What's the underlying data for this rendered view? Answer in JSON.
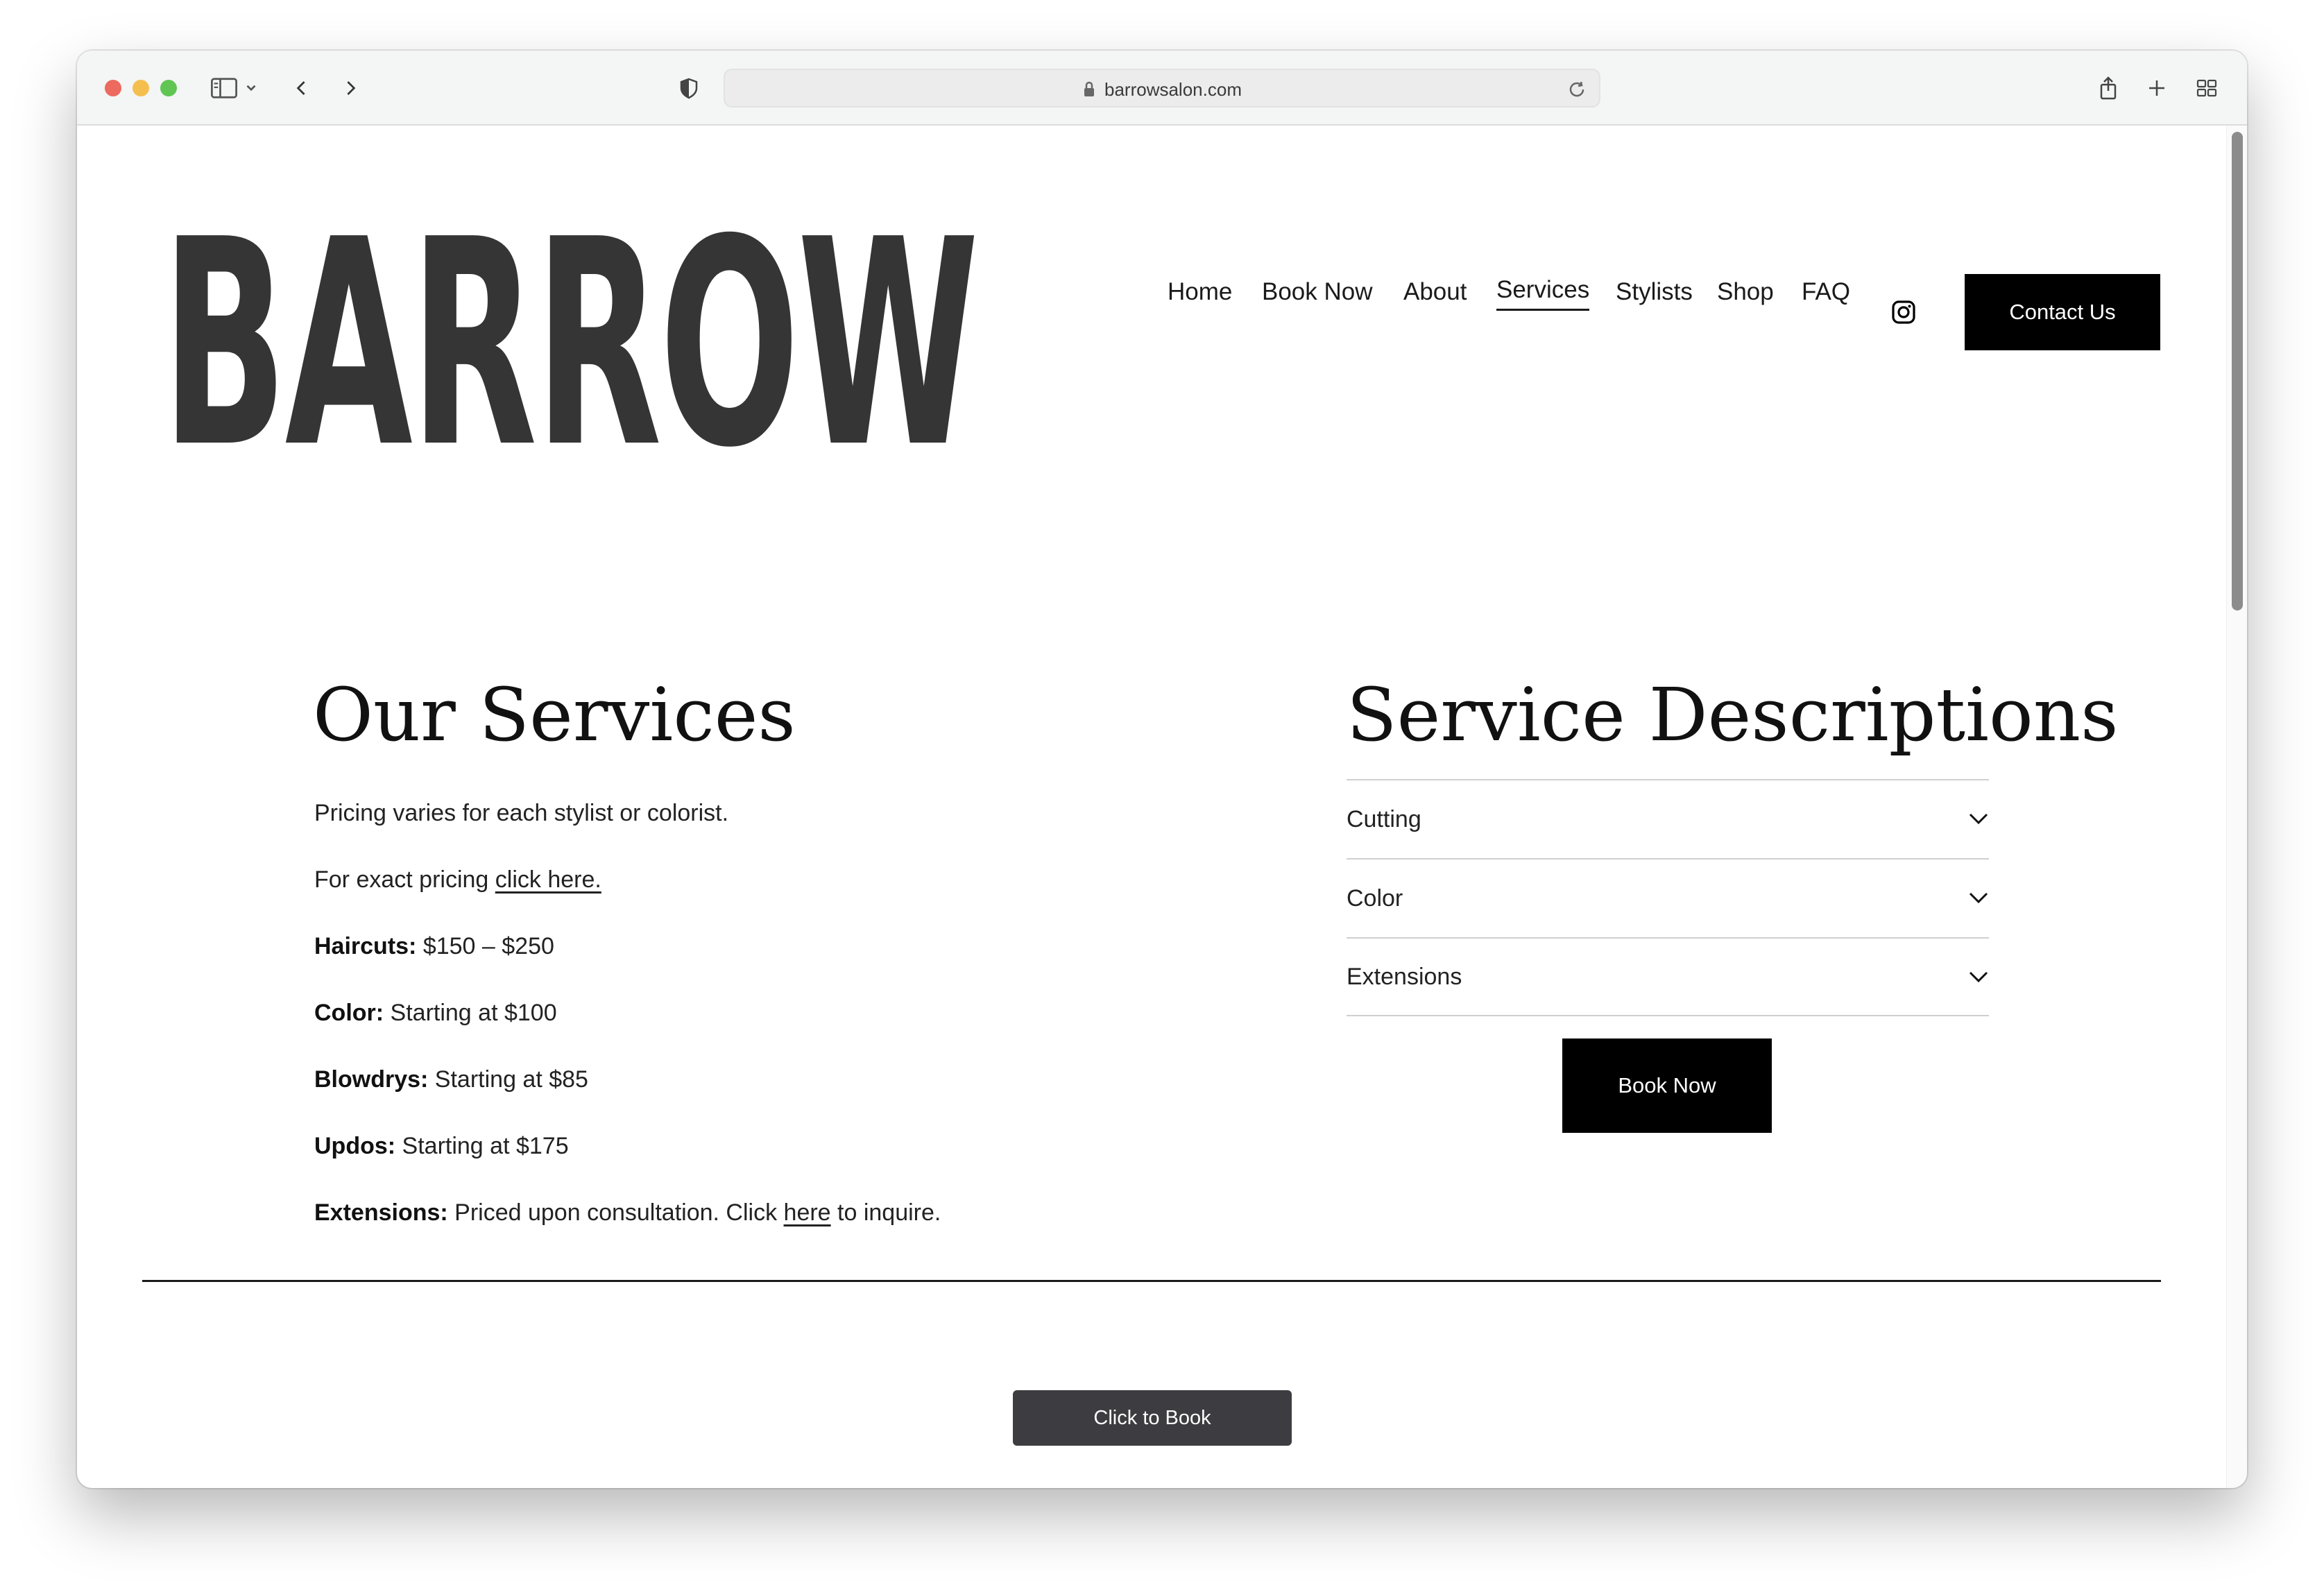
{
  "browser": {
    "url": "barrowsalon.com"
  },
  "site": {
    "logo": "BARROW",
    "nav": [
      {
        "label": "Home"
      },
      {
        "label": "Book Now"
      },
      {
        "label": "About"
      },
      {
        "label": "Services",
        "active": true
      },
      {
        "label": "Stylists"
      },
      {
        "label": "Shop"
      },
      {
        "label": "FAQ"
      }
    ],
    "contact_label": "Contact Us"
  },
  "services": {
    "heading": "Our Services",
    "intro": "Pricing varies for each stylist or colorist.",
    "pricing_prefix": "For exact pricing ",
    "pricing_link": "click here.",
    "items": [
      {
        "name": "Haircuts:",
        "detail": " $150 – $250"
      },
      {
        "name": "Color:",
        "detail": " Starting at $100"
      },
      {
        "name": "Blowdrys:",
        "detail": " Starting at $85"
      },
      {
        "name": "Updos:",
        "detail": " Starting at $175"
      }
    ],
    "extensions": {
      "name": "Extensions:",
      "detail_before": " Priced upon consultation. Click ",
      "link": "here",
      "detail_after": " to inquire."
    }
  },
  "descriptions": {
    "heading": "Service Descriptions",
    "accordion": [
      {
        "label": "Cutting"
      },
      {
        "label": "Color"
      },
      {
        "label": "Extensions"
      }
    ],
    "book_label": "Book Now"
  },
  "footer": {
    "click_to_book": "Click to Book"
  }
}
